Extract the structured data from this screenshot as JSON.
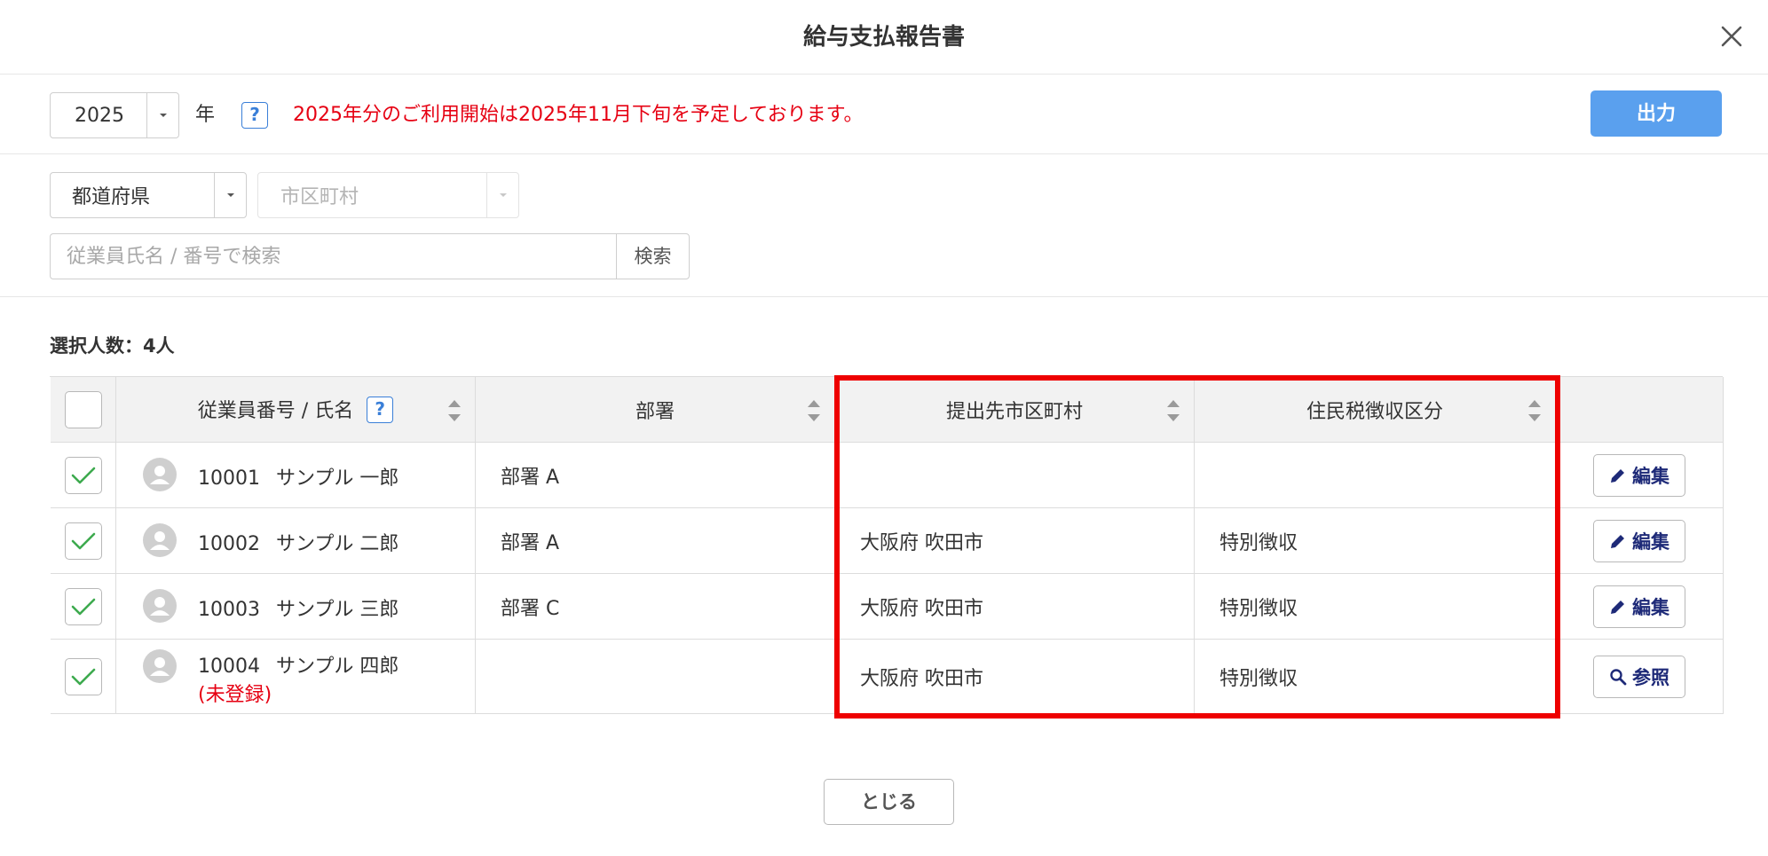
{
  "header": {
    "title": "給与支払報告書"
  },
  "year_bar": {
    "year": "2025",
    "year_unit": "年",
    "help": "?",
    "notice": "2025年分のご利用開始は2025年11月下旬を予定しております。",
    "output_label": "出力"
  },
  "filter": {
    "prefecture": "都道府県",
    "city": "市区町村",
    "search_placeholder": "従業員氏名 / 番号で検索",
    "search_label": "検索"
  },
  "selected_count": "選択人数：4人",
  "table": {
    "headers": {
      "employee": "従業員番号 / 氏名",
      "employee_help": "?",
      "department": "部署",
      "city": "提出先市区町村",
      "tax": "住民税徴収区分"
    },
    "rows": [
      {
        "number": "10001",
        "name": "サンプル 一郎",
        "note": "",
        "department": "部署 A",
        "city": "",
        "tax": "",
        "action": "編集",
        "action_icon": "pencil-icon"
      },
      {
        "number": "10002",
        "name": "サンプル 二郎",
        "note": "",
        "department": "部署 A",
        "city": "大阪府 吹田市",
        "tax": "特別徴収",
        "action": "編集",
        "action_icon": "pencil-icon"
      },
      {
        "number": "10003",
        "name": "サンプル 三郎",
        "note": "",
        "department": "部署 C",
        "city": "大阪府 吹田市",
        "tax": "特別徴収",
        "action": "編集",
        "action_icon": "pencil-icon"
      },
      {
        "number": "10004",
        "name": "サンプル 四郎",
        "note": "(未登録)",
        "department": "",
        "city": "大阪府 吹田市",
        "tax": "特別徴収",
        "action": "参照",
        "action_icon": "magnifier-icon"
      }
    ]
  },
  "footer": {
    "close_label": "とじる"
  },
  "colors": {
    "accent": "#5aa0ee",
    "notice": "#e60012",
    "highlight": "#ee0000",
    "check": "#3daa4e",
    "button_text": "#1e2a78"
  }
}
